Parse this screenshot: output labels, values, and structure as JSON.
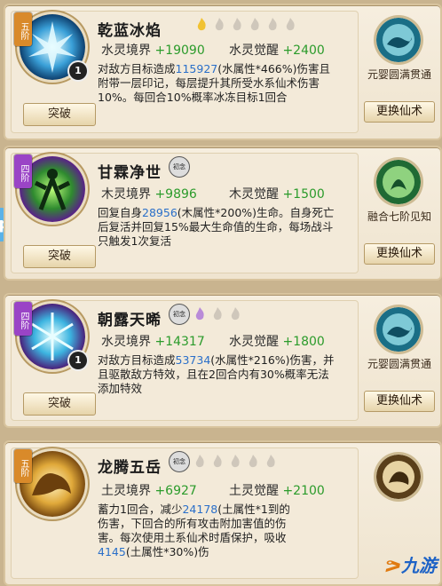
{
  "colors": {
    "accent_green": "#2b9b2b",
    "accent_blue": "#2a6fc9",
    "brand_blue": "#1e63c6"
  },
  "cards": [
    {
      "name": "乾蓝冰焰",
      "tier": "五阶",
      "count": "1",
      "break_label": "突破",
      "realm_label": "水灵境界",
      "realm_value": "+19090",
      "awaken_label": "水灵觉醒",
      "awaken_value": "+2400",
      "desc_a": "对敌方目标造成",
      "desc_hl": "115927",
      "desc_b": "(水属性*466%)伤害且附带一层印记，每层提升其所受水系仙术伤害10%。每回合10%概率冰冻目标1回合",
      "side_text": "元婴圆满贯通",
      "change_label": "更换仙术",
      "icon": "ice-crystal-icon",
      "emblem": "water-beast-icon"
    },
    {
      "name": "甘霖净世",
      "badge": "初念",
      "tier": "四阶",
      "break_label": "突破",
      "realm_label": "木灵境界",
      "realm_value": "+9896",
      "awaken_label": "木灵觉醒",
      "awaken_value": "+1500",
      "desc_a": "回复自身",
      "desc_hl": "28956",
      "desc_b": "(木属性*200%)生命。自身死亡后复活并回复15%最大生命值的生命，每场战斗只触发1次复活",
      "side_text": "融合七阶见知",
      "change_label": "更换仙术",
      "icon": "spirit-figure-icon",
      "emblem": "wood-spirit-icon"
    },
    {
      "name": "朝露天晞",
      "badge": "初念",
      "tier": "四阶",
      "count": "1",
      "break_label": "突破",
      "realm_label": "水灵境界",
      "realm_value": "+14317",
      "awaken_label": "水灵觉醒",
      "awaken_value": "+1800",
      "desc_a": "对敌方目标造成",
      "desc_hl": "53734",
      "desc_b": "(水属性*216%)伤害，并且驱散敌方特效，且在2回合内有30%概率无法添加特效",
      "side_text": "元婴圆满贯通",
      "change_label": "更换仙术",
      "icon": "snowflake-icon",
      "emblem": "water-beast-icon"
    },
    {
      "name": "龙腾五岳",
      "badge": "初念",
      "tier": "五阶",
      "break_label": "突破",
      "realm_label": "土灵境界",
      "realm_value": "+6927",
      "awaken_label": "土灵觉醒",
      "awaken_value": "+2100",
      "desc_a": "蓄力1回合，减少",
      "desc_hl": "24178",
      "desc_b": "(土属性*1到的伤害，下回合的所有攻击附加害值的伤害。每次使用土系仙术时盾保护，吸收",
      "desc_hl2": "4145",
      "desc_c": "(土属性*30%)伤",
      "icon": "dragon-icon",
      "emblem": "earth-beast-icon"
    }
  ],
  "side_tab": "p",
  "watermark": "九游"
}
